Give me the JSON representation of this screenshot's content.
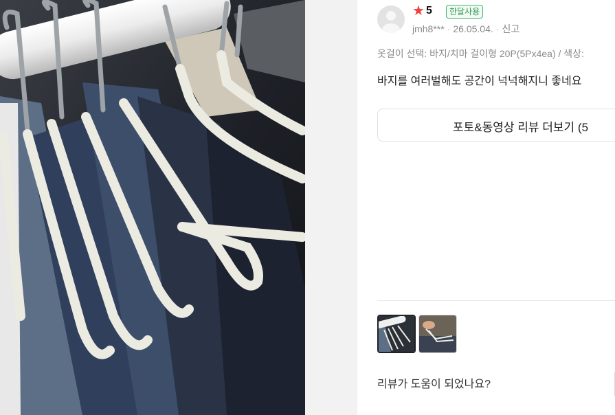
{
  "review": {
    "rating": "5",
    "badge": "한달사용",
    "author": "jmh8***",
    "date": "26.05.04.",
    "report_label": "신고",
    "option": "옷걸이 선택: 바지/치마 걸이형 20P(5Px4ea) / 색상:",
    "text": "바지를 여러벌해도 공간이 넉넉해지니 좋네요",
    "more_button_label": "포토&동영상 리뷰 더보기 (5",
    "helpful_question": "리뷰가 도움이 되었나요?"
  },
  "icons": {
    "avatar": "default-avatar-icon",
    "star": "star-icon"
  },
  "colors": {
    "star": "#f23f3f",
    "badge_text": "#2c9b52",
    "badge_border": "#43b56c"
  }
}
